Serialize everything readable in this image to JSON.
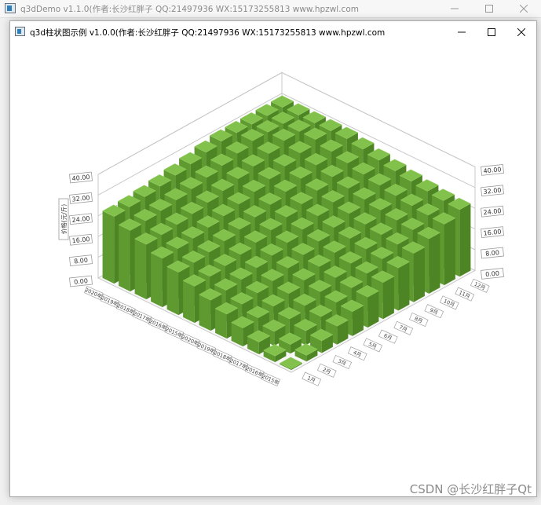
{
  "outer_window": {
    "title": "q3dDemo v1.1.0(作者:长沙红胖子 QQ:21497936 WX:15173255813 www.hpzwl.com"
  },
  "window": {
    "title": "q3d柱状图示例 v1.0.0(作者:长沙红胖子 QQ:21497936 WX:15173255813 www.hpzwl.com"
  },
  "graph": {
    "y_axis_title": "价格(元/斤)",
    "y_ticks": [
      "0.00",
      "8.00",
      "16.00",
      "24.00",
      "32.00",
      "40.00"
    ],
    "row_axis_labels": [
      "2015年",
      "2016年",
      "2017年",
      "2018年",
      "2019年",
      "2020年"
    ],
    "column_axis_labels": [
      "1月",
      "2月",
      "3月",
      "4月",
      "5月",
      "6月",
      "7月",
      "8月",
      "9月",
      "10月",
      "11月",
      "12月"
    ],
    "bar_color": "#6aa83a",
    "rows": 12,
    "columns": 12
  },
  "chart_data": {
    "type": "bar",
    "title": "",
    "ylabel": "价格(元/斤)",
    "ylim": [
      0,
      40
    ],
    "x": [
      "1月",
      "2月",
      "3月",
      "4月",
      "5月",
      "6月",
      "7月",
      "8月",
      "9月",
      "10月",
      "11月",
      "12月"
    ],
    "values_rule": "bar height grows with distance from front corner; front-corner bar ≈ 0, back corner ≈ 32"
  },
  "watermark": "CSDN @长沙红胖子Qt",
  "colors": {
    "bar_top": "#82c24c",
    "bar_left": "#5e9a2f",
    "bar_right": "#4d8524"
  }
}
